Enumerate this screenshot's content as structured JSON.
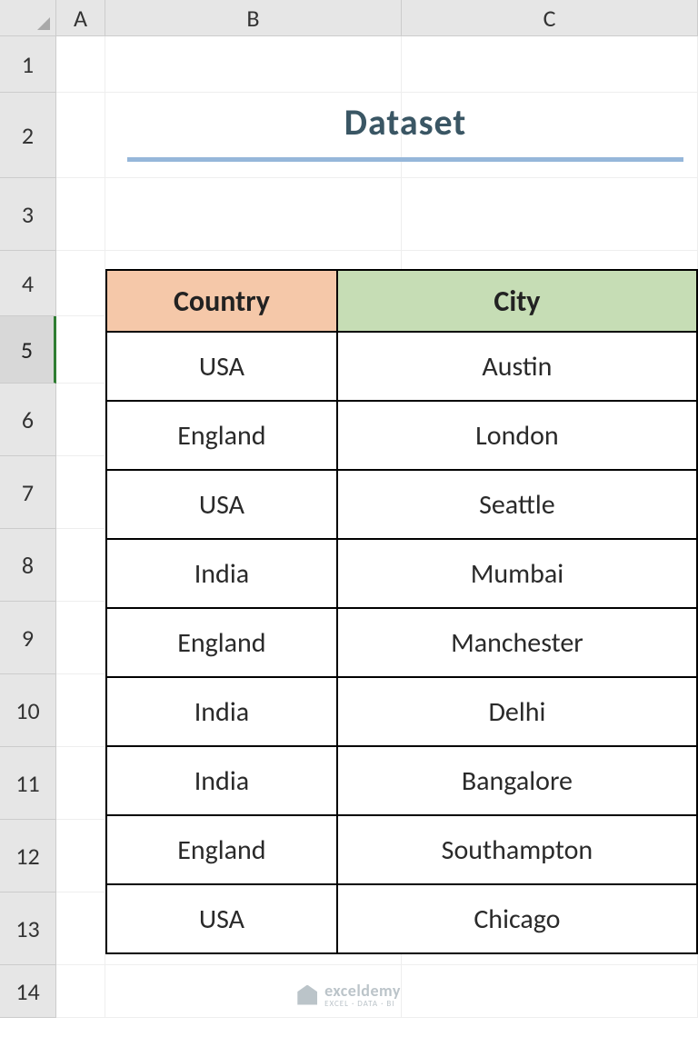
{
  "columns": [
    "A",
    "B",
    "C"
  ],
  "rows": [
    "1",
    "2",
    "3",
    "4",
    "5",
    "6",
    "7",
    "8",
    "9",
    "10",
    "11",
    "12",
    "13",
    "14"
  ],
  "selected_row": "5",
  "title": "Dataset",
  "table": {
    "headers": {
      "country": "Country",
      "city": "City"
    },
    "rows": [
      {
        "country": "USA",
        "city": "Austin"
      },
      {
        "country": "England",
        "city": "London"
      },
      {
        "country": "USA",
        "city": "Seattle"
      },
      {
        "country": "India",
        "city": "Mumbai"
      },
      {
        "country": "England",
        "city": "Manchester"
      },
      {
        "country": "India",
        "city": "Delhi"
      },
      {
        "country": "India",
        "city": "Bangalore"
      },
      {
        "country": "England",
        "city": "Southampton"
      },
      {
        "country": "USA",
        "city": "Chicago"
      }
    ]
  },
  "watermark": {
    "brand": "exceldemy",
    "tagline": "EXCEL · DATA · BI"
  }
}
